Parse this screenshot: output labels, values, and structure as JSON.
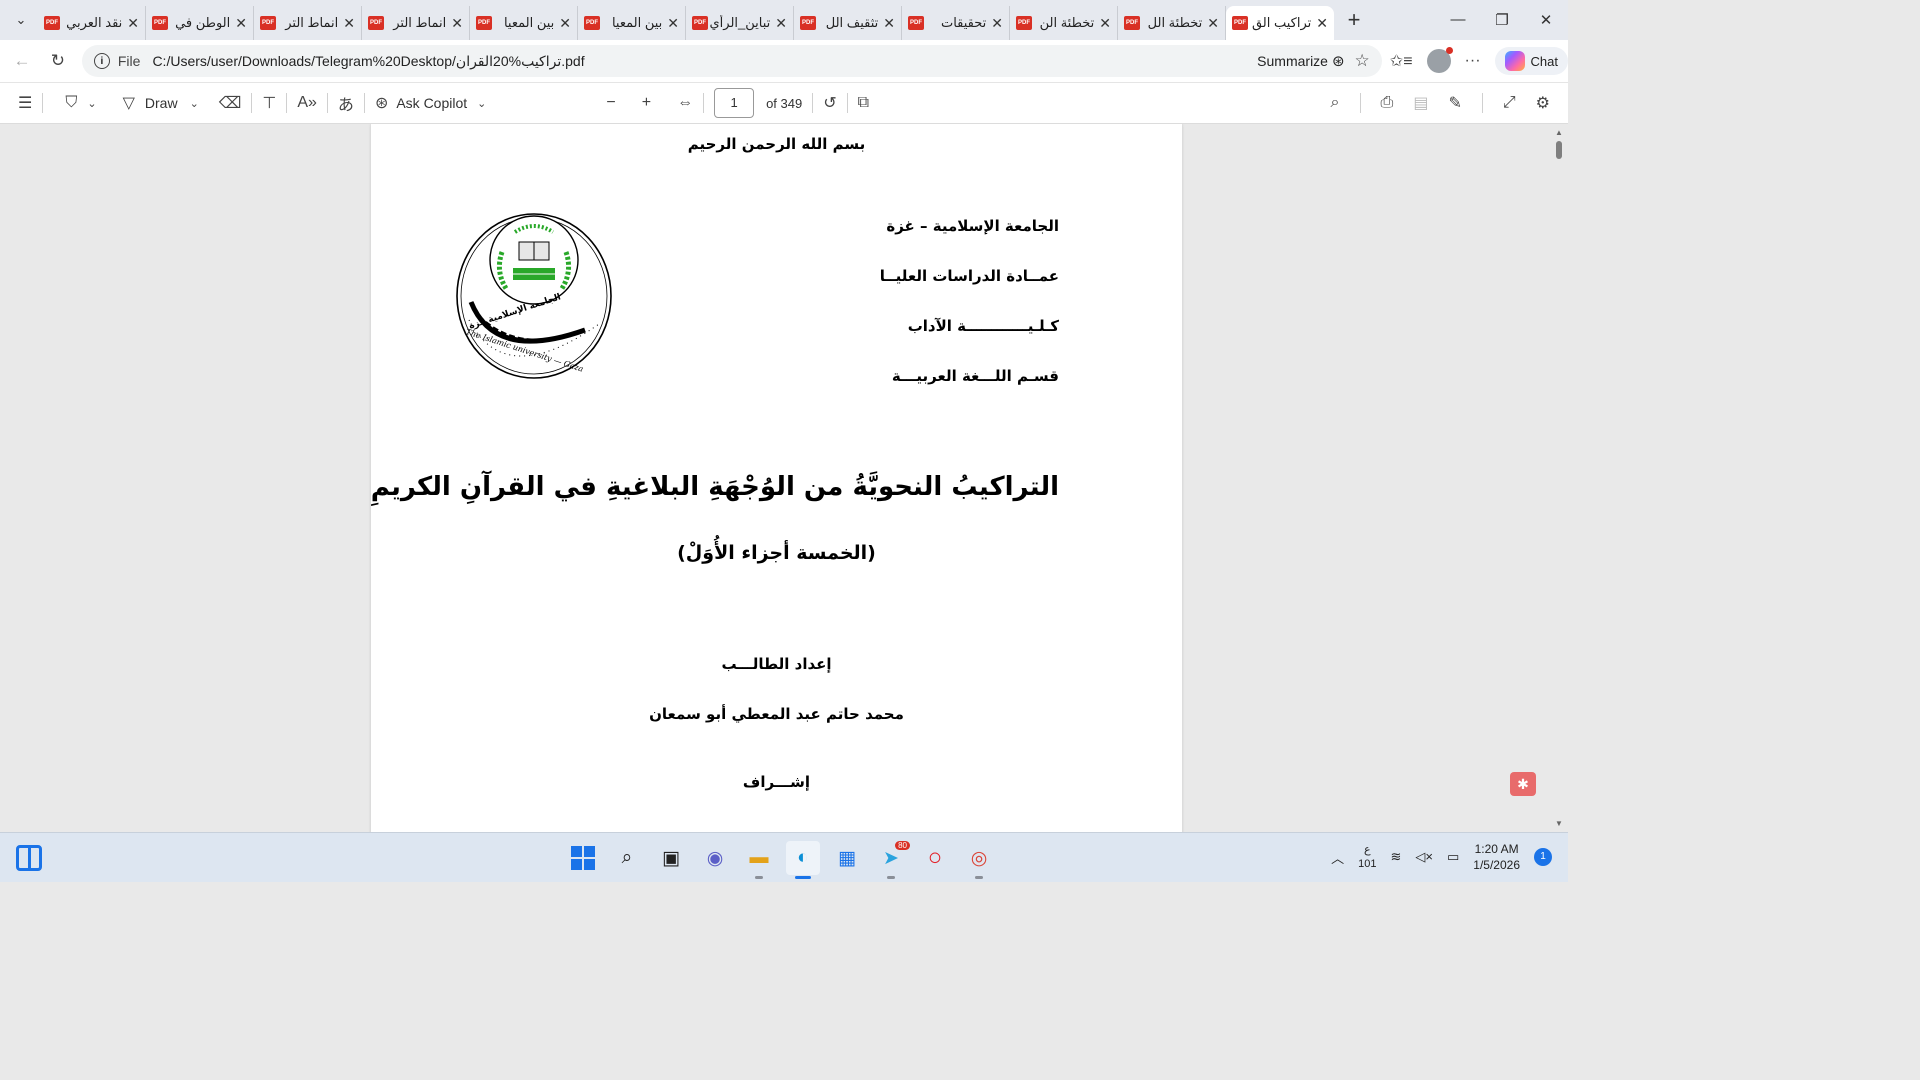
{
  "tabs": [
    {
      "title": "نقد العربي"
    },
    {
      "title": "الوطن في"
    },
    {
      "title": "انماط التر"
    },
    {
      "title": "انماط التر"
    },
    {
      "title": "بين المعيا"
    },
    {
      "title": "بين المعيا"
    },
    {
      "title": "تباين_الرأي"
    },
    {
      "title": "تثقيف الل"
    },
    {
      "title": "تحقيقات"
    },
    {
      "title": "تخطئة الن"
    },
    {
      "title": "تخطئة الل"
    },
    {
      "title": "تراكيب الق"
    }
  ],
  "address": {
    "scheme_label": "File",
    "url": "C:/Users/user/Downloads/Telegram%20Desktop/تراكيب%20القران.pdf",
    "summarize_label": "Summarize",
    "chat_label": "Chat"
  },
  "pdf_toolbar": {
    "draw_label": "Draw",
    "copilot_label": "Ask Copilot",
    "page_value": "1",
    "page_total": "of 349"
  },
  "document": {
    "basmala": "بسم الله الرحمن الرحيم",
    "header_lines": [
      "الجامعة الإسلامية – غزة",
      "عمــادة الدراسات العليــا",
      "كـلـيــــــــــــة الآداب",
      "قسـم اللـــغة العربيـــة"
    ],
    "logo_arabic": "الجامعة الإسلامية غزة",
    "logo_english": "The Islamic university — Gaza",
    "main_title": "التراكيبُ النحويَّةُ من الوُجْهَةِ البلاغيةِ في القرآنِ الكريمِ",
    "subtitle": "(الخمسة أجزاء الأُوَلْ)",
    "prepared_by_label": "إعداد الطالـــب",
    "student_name": "محمد حاتم عبد المعطي أبو سمعان",
    "supervision_label": "إشـــراف"
  },
  "taskbar": {
    "telegram_badge": "80",
    "lang_top": "ع",
    "lang_bottom": "101",
    "time": "1:20 AM",
    "date": "1/5/2026",
    "notifications": "1"
  }
}
